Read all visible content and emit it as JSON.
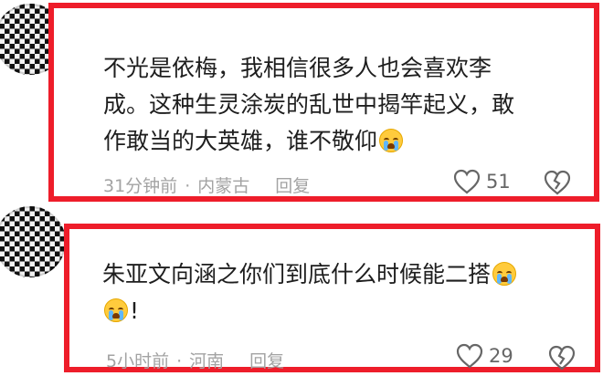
{
  "comments": [
    {
      "text_lines": [
        "不光是依梅，我相信很多人也会喜欢李",
        "成。这种生灵涂炭的乱世中揭竿起义，敢",
        "作敢当的大英雄，谁不敬仰"
      ],
      "trailing_emoji": "crying-face-emoji",
      "time": "31分钟前",
      "location": "内蒙古",
      "reply_label": "回复",
      "likes": "51"
    },
    {
      "text_lines": [
        "朱亚文向涵之你们到底什么时候能二搭",
        "!"
      ],
      "trailing_emoji": "crying-face-emoji",
      "time": "5小时前",
      "location": "河南",
      "reply_label": "回复",
      "likes": "29"
    }
  ],
  "separator": "·",
  "colors": {
    "highlight_border": "#ee1d2a",
    "meta_text": "#a3a3a3",
    "emoji": "#ffcb3d"
  }
}
